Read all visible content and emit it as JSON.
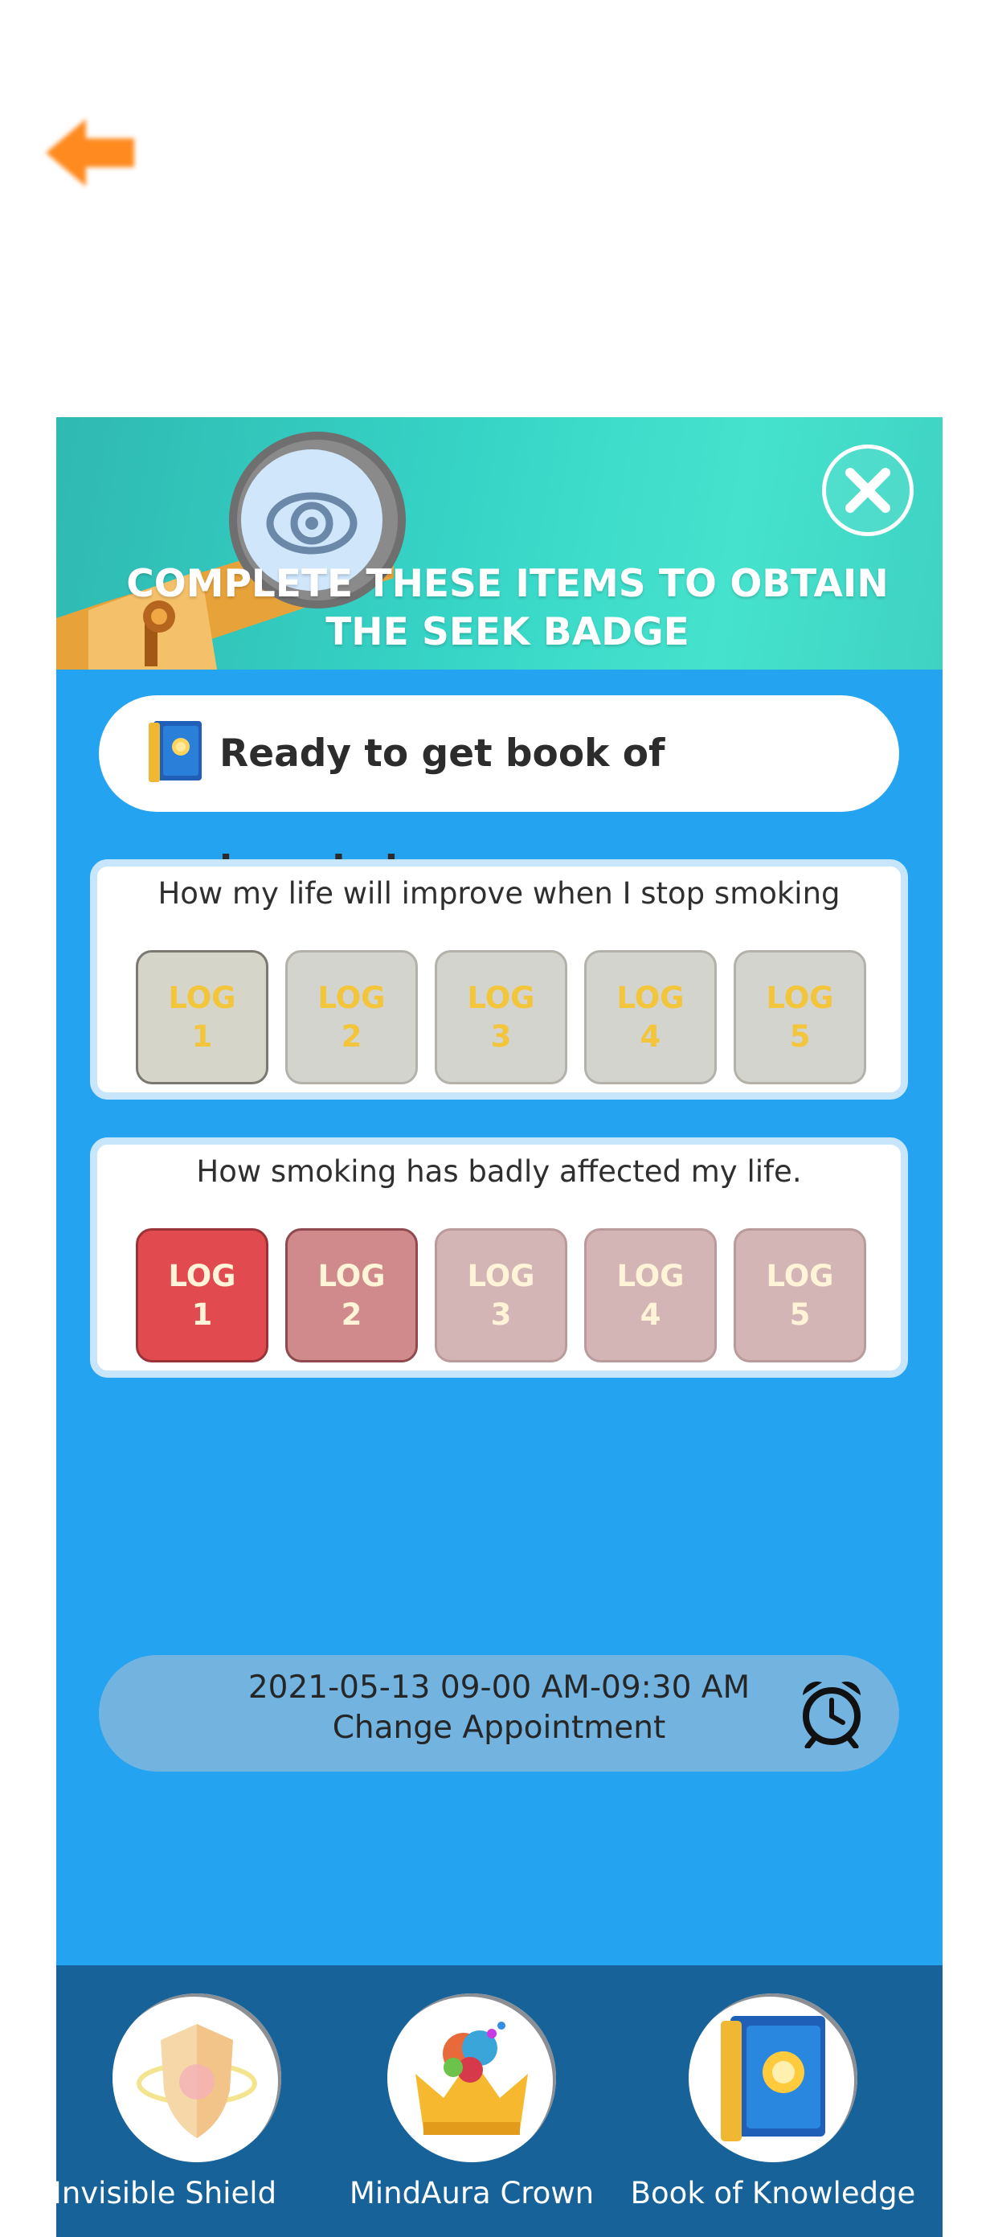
{
  "banner": {
    "title_line1": "COMPLETE THESE ITEMS TO OBTAIN",
    "title_line2": "THE SEEK BADGE"
  },
  "goal": {
    "text": "Ready to get book of knowledge"
  },
  "tasks": [
    {
      "title": "How my life will improve when I stop smoking",
      "logs": [
        {
          "l1": "LOG",
          "l2": "1"
        },
        {
          "l1": "LOG",
          "l2": "2"
        },
        {
          "l1": "LOG",
          "l2": "3"
        },
        {
          "l1": "LOG",
          "l2": "4"
        },
        {
          "l1": "LOG",
          "l2": "5"
        }
      ]
    },
    {
      "title": "How smoking has badly affected my life.",
      "logs": [
        {
          "l1": "LOG",
          "l2": "1"
        },
        {
          "l1": "LOG",
          "l2": "2"
        },
        {
          "l1": "LOG",
          "l2": "3"
        },
        {
          "l1": "LOG",
          "l2": "4"
        },
        {
          "l1": "LOG",
          "l2": "5"
        }
      ]
    }
  ],
  "appointment": {
    "datetime": "2021-05-13 09-00 AM-09:30 AM",
    "change_label": "Change Appointment"
  },
  "badges": [
    {
      "label": "Invisible Shield",
      "icon": "shield-icon"
    },
    {
      "label": "MindAura Crown",
      "icon": "crown-icon"
    },
    {
      "label": "Book of Knowledge",
      "icon": "book-icon"
    }
  ],
  "colors": {
    "banner": "#3ed7c8",
    "panel": "#23a3f0",
    "badge_bar": "#176399",
    "log_done": "#e14a4e",
    "log_pending": "#d4d4cf",
    "back_arrow": "#ff8a1f"
  }
}
